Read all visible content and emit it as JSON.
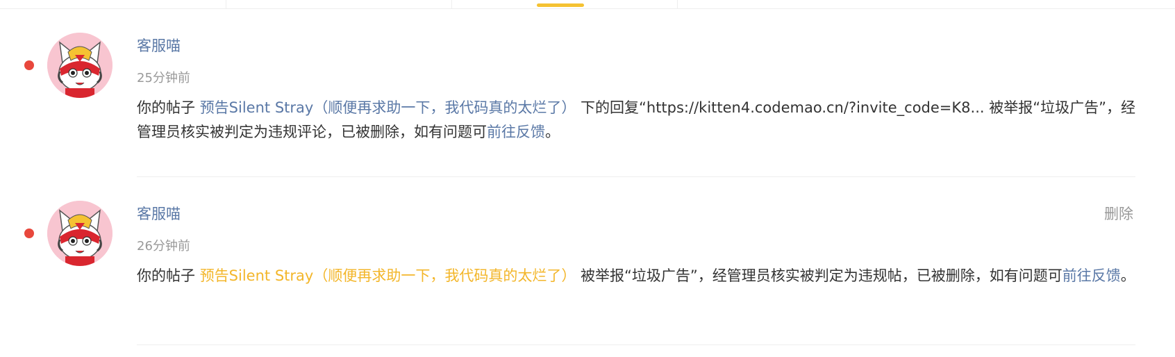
{
  "colors": {
    "tab_indicator": "#f5c232",
    "unread_dot": "#e8473c",
    "link_blue": "#5a78a6",
    "link_yellow": "#f3b62a",
    "muted": "#999999",
    "text": "#333333"
  },
  "notices": [
    {
      "sender": "客服喵",
      "time": "25分钟前",
      "unread": true,
      "delete_label": "",
      "text_prefix": "你的帖子 ",
      "post_link": "预告Silent Stray（顺便再求助一下，我代码真的太烂了）",
      "text_middle": " 下的回复“https://kitten4.codemao.cn/?invite_code=K8... 被举报“垃圾广告”，经管理员核实被判定为违规评论，已被删除，如有问题可",
      "feedback_link": "前往反馈",
      "text_end": "。"
    },
    {
      "sender": "客服喵",
      "time": "26分钟前",
      "unread": true,
      "delete_label": "删除",
      "text_prefix": "你的帖子 ",
      "post_link": "预告Silent Stray（顺便再求助一下，我代码真的太烂了）",
      "text_middle": " 被举报“垃圾广告”，经管理员核实被判定为违规帖，已被删除，如有问题可",
      "feedback_link": "前往反馈",
      "text_end": "。"
    }
  ]
}
